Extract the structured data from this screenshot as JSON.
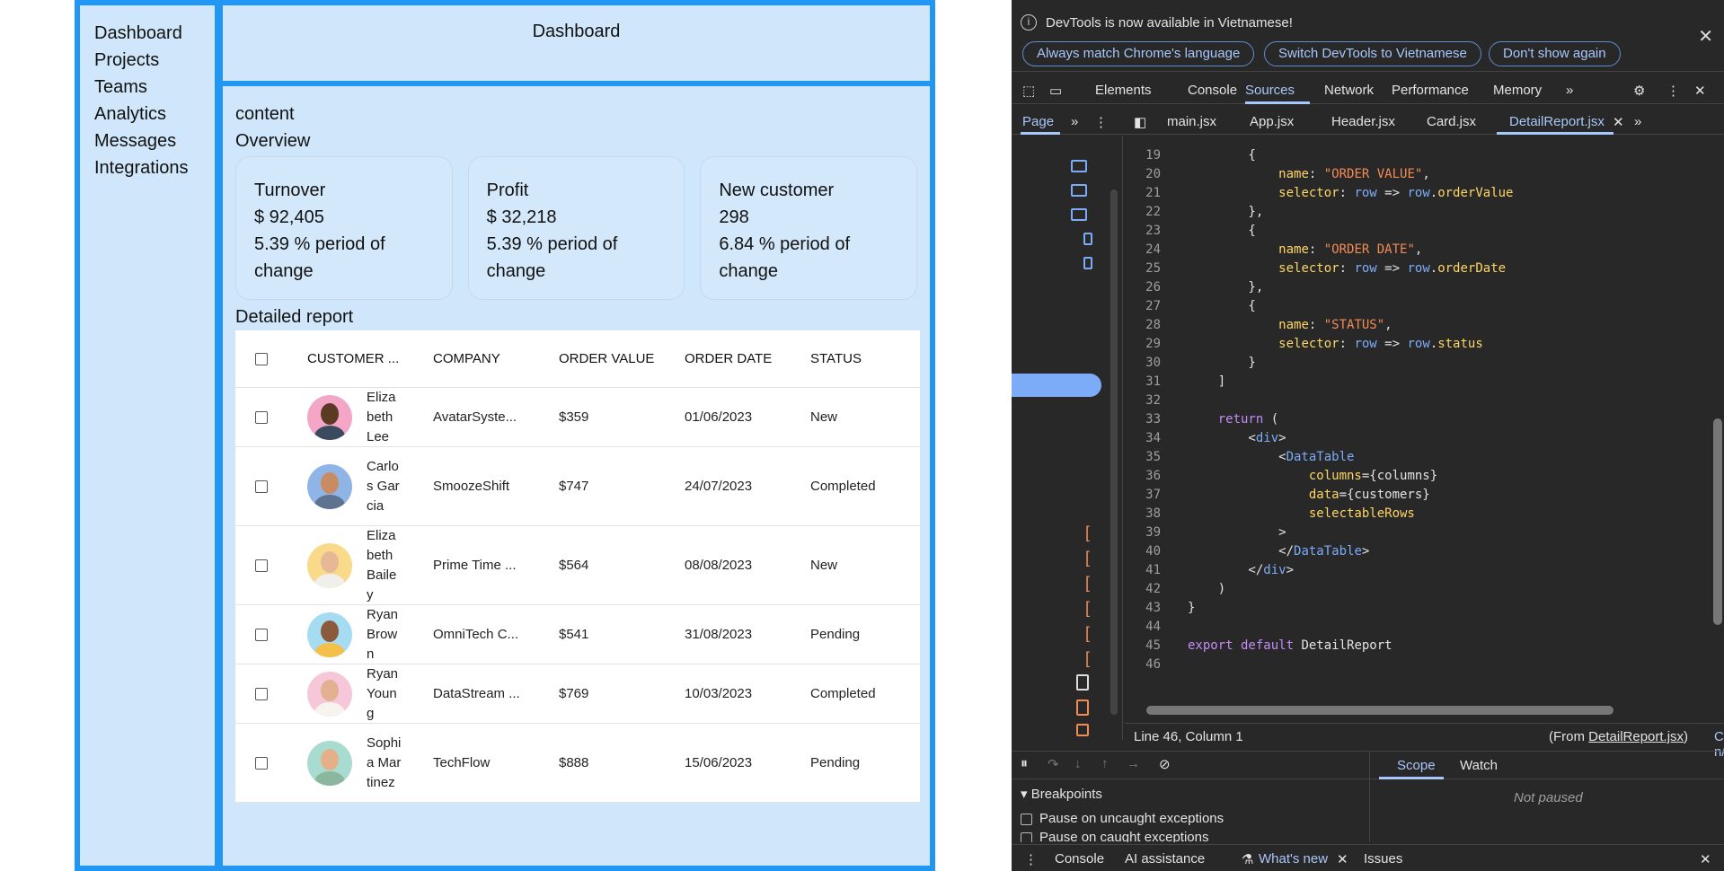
{
  "sidebar": {
    "items": [
      "Dashboard",
      "Projects",
      "Teams",
      "Analytics",
      "Messages",
      "Integrations"
    ]
  },
  "header": {
    "title": "Dashboard"
  },
  "main": {
    "content_label": "content",
    "overview_label": "Overview",
    "cards": [
      {
        "title": "Turnover",
        "value": "$ 92,405",
        "change": "5.39 % period of change"
      },
      {
        "title": "Profit",
        "value": "$ 32,218",
        "change": "5.39 % period of change"
      },
      {
        "title": "New customer",
        "value": "298",
        "change": "6.84 % period of change"
      }
    ],
    "report_title": "Detailed report",
    "table": {
      "headers": [
        "CUSTOMER ...",
        "COMPANY",
        "ORDER VALUE",
        "ORDER DATE",
        "STATUS"
      ],
      "rows": [
        {
          "name": "Elizabeth Lee",
          "company": "AvatarSyste...",
          "value": "$359",
          "date": "01/06/2023",
          "status": "New",
          "avatar_bg": "#f4a6c7",
          "skin": "#5a3a22",
          "shirt": "#3b4a5e"
        },
        {
          "name": "Carlos Garcia",
          "company": "SmoozeShift",
          "value": "$747",
          "date": "24/07/2023",
          "status": "Completed",
          "avatar_bg": "#8fb5e6",
          "skin": "#c98c62",
          "shirt": "#5e7390"
        },
        {
          "name": "Elizabeth Bailey",
          "company": "Prime Time ...",
          "value": "$564",
          "date": "08/08/2023",
          "status": "New",
          "avatar_bg": "#f9d98a",
          "skin": "#e7b896",
          "shirt": "#f0efe9"
        },
        {
          "name": "Ryan Brown",
          "company": "OmniTech C...",
          "value": "$541",
          "date": "31/08/2023",
          "status": "Pending",
          "avatar_bg": "#a6dcf2",
          "skin": "#8a5a3a",
          "shirt": "#f3c04a"
        },
        {
          "name": "Ryan Young",
          "company": "DataStream ...",
          "value": "$769",
          "date": "10/03/2023",
          "status": "Completed",
          "avatar_bg": "#f6c6d9",
          "skin": "#e2b191",
          "shirt": "#f7f3ee"
        },
        {
          "name": "Sophia Martinez",
          "company": "TechFlow",
          "value": "$888",
          "date": "15/06/2023",
          "status": "Pending",
          "avatar_bg": "#a9dcd0",
          "skin": "#e3b08a",
          "shirt": "#8cb79f"
        }
      ]
    }
  },
  "devtools": {
    "banner": {
      "message": "DevTools is now available in Vietnamese!",
      "buttons": [
        "Always match Chrome's language",
        "Switch DevTools to Vietnamese",
        "Don't show again"
      ]
    },
    "tabs": [
      "Elements",
      "Console",
      "Sources",
      "Network",
      "Performance",
      "Memory"
    ],
    "active_tab": "Sources",
    "nav_tab": "Page",
    "files": [
      "main.jsx",
      "App.jsx",
      "Header.jsx",
      "Card.jsx",
      "DetailReport.jsx"
    ],
    "active_file": "DetailReport.jsx",
    "status": {
      "position": "Line 46, Column 1",
      "from_prefix": "(From ",
      "from_file": "DetailReport.jsx",
      "from_suffix": ")",
      "coverage": "Coverage: n/a"
    },
    "debug": {
      "breakpoints_label": "Breakpoints",
      "pause_uncaught": "Pause on uncaught exceptions",
      "pause_caught": "Pause on caught exceptions",
      "scope_tab": "Scope",
      "watch_tab": "Watch",
      "not_paused": "Not paused"
    },
    "drawer_tabs": [
      "Console",
      "AI assistance",
      "What's new",
      "Issues"
    ],
    "code_line_numbers": [
      "19",
      "20",
      "21",
      "22",
      "23",
      "24",
      "25",
      "26",
      "27",
      "28",
      "29",
      "30",
      "31",
      "32",
      "33",
      "34",
      "35",
      "36",
      "37",
      "38",
      "39",
      "40",
      "41",
      "42",
      "43",
      "44",
      "45",
      "46"
    ]
  }
}
